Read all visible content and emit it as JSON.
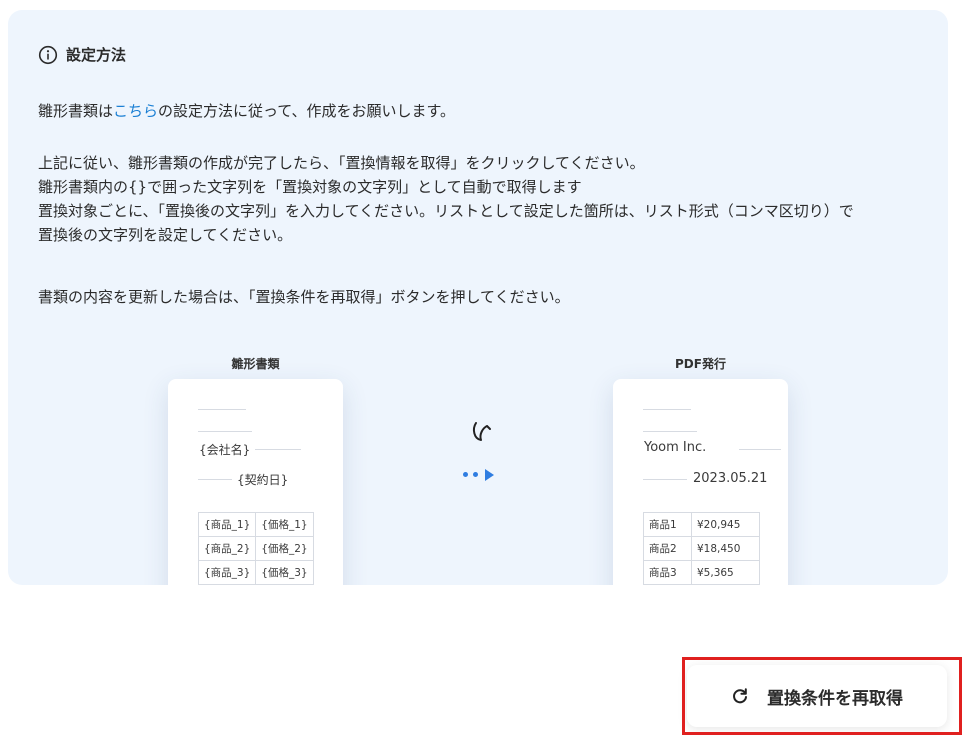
{
  "settings": {
    "title": "設定方法",
    "line1_prefix": "雛形書類は",
    "line1_link": "こちら",
    "line1_suffix": "の設定方法に従って、作成をお願いします。",
    "lines": [
      "上記に従い、雛形書類の作成が完了したら、「置換情報を取得」をクリックしてください。",
      "雛形書類内の{}で囲った文字列を「置換対象の文字列」として自動で取得します",
      "置換対象ごとに、「置換後の文字列」を入力してください。リストとして設定した箇所は、リスト形式（コンマ区切り）で",
      "置換後の文字列を設定してください。"
    ],
    "update_note": "書類の内容を更新した場合は、「置換条件を再取得」ボタンを押してください。"
  },
  "illustration": {
    "template": {
      "label": "雛形書類",
      "company": "{会社名}",
      "date": "{契約日}",
      "rows": [
        [
          "{商品_1}",
          "{価格_1}"
        ],
        [
          "{商品_2}",
          "{価格_2}"
        ],
        [
          "{商品_3}",
          "{価格_3}"
        ]
      ]
    },
    "output": {
      "label": "PDF発行",
      "company": "Yoom Inc.",
      "date": "2023.05.21",
      "rows": [
        [
          "商品1",
          "¥20,945"
        ],
        [
          "商品2",
          "¥18,450"
        ],
        [
          "商品3",
          "¥5,365"
        ]
      ]
    },
    "accent_color": "#2f7de1"
  },
  "actions": {
    "refresh_label": "置換条件を再取得"
  },
  "colors": {
    "panel_bg": "#eef5fd",
    "link": "#1a7fd4",
    "highlight": "#e0201f"
  }
}
